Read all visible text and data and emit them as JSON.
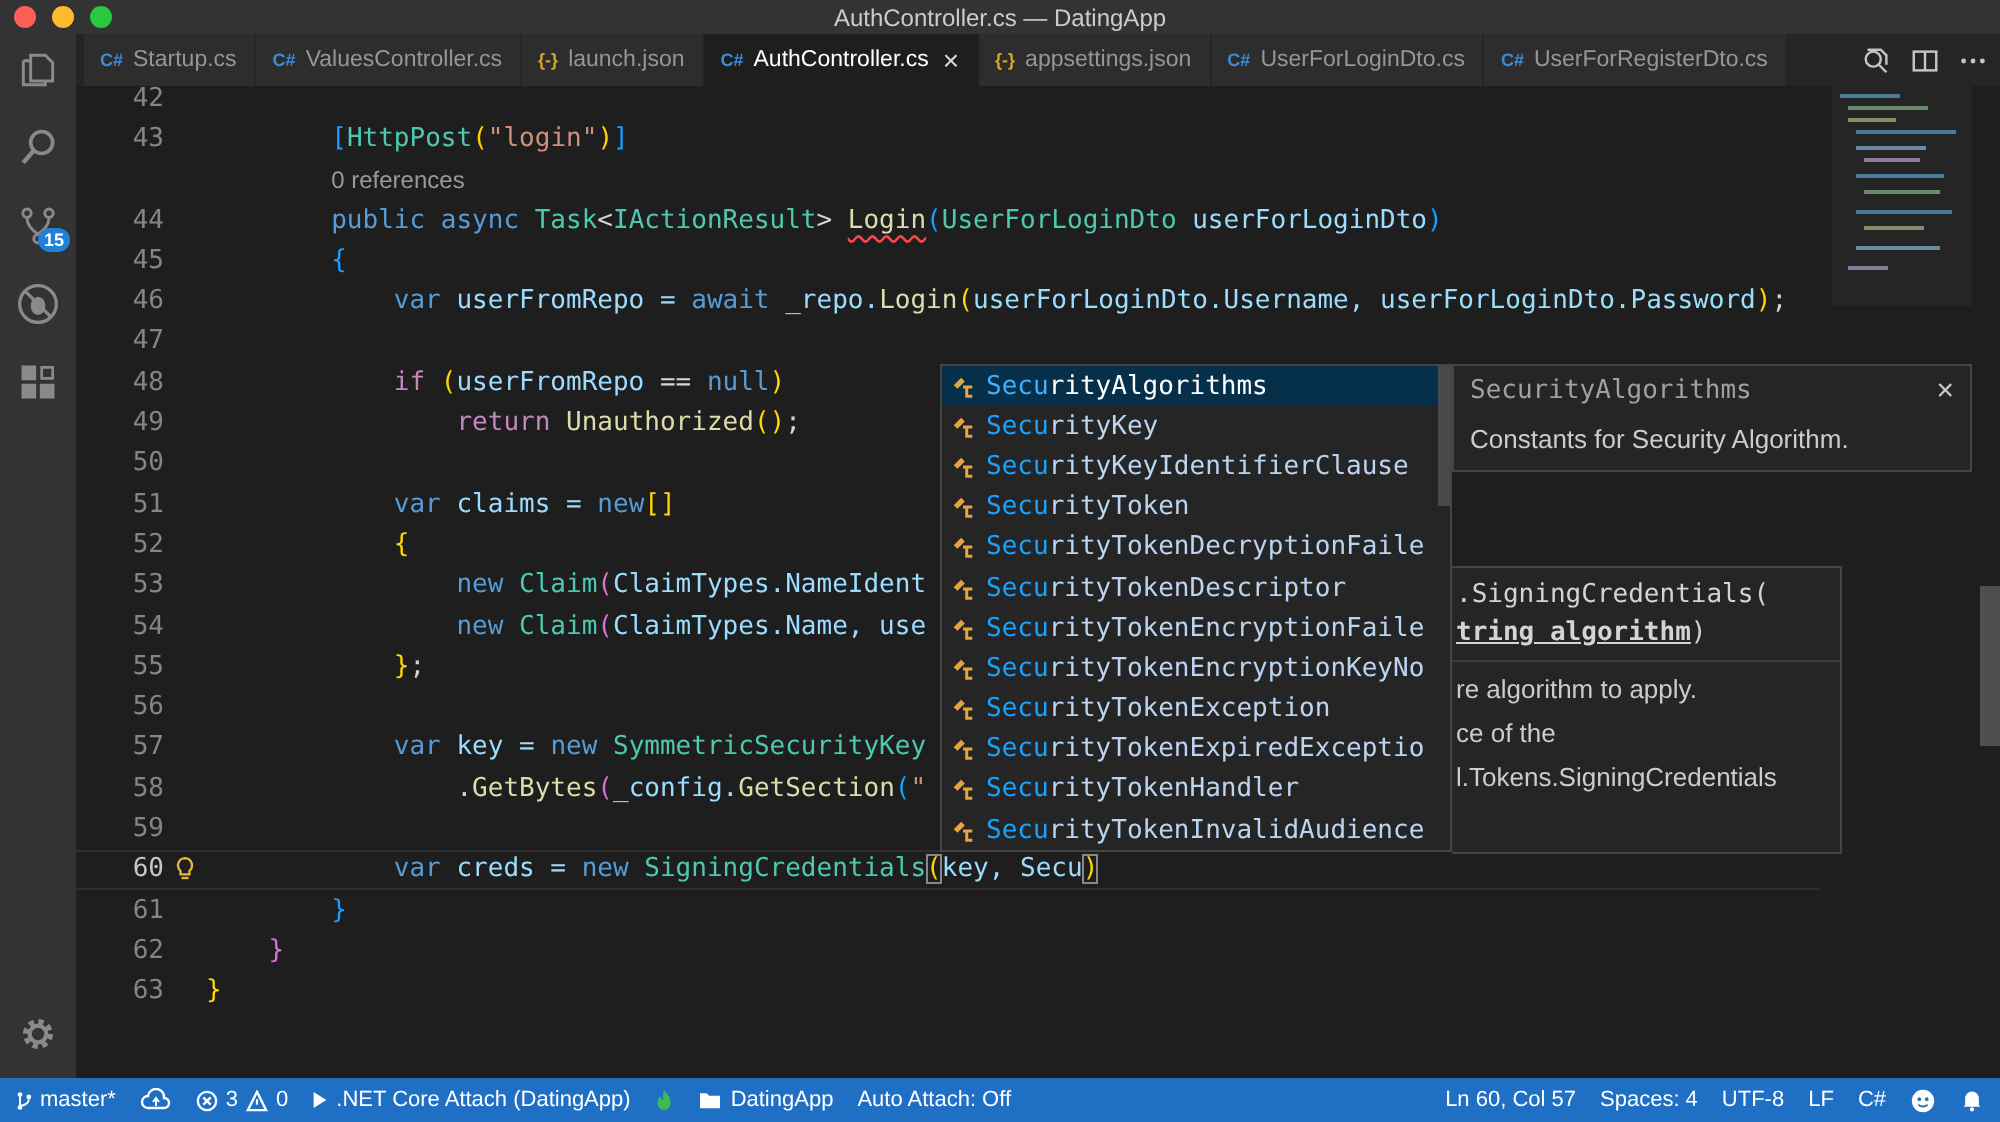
{
  "window": {
    "title": "AuthController.cs — DatingApp"
  },
  "tabs": [
    {
      "icon": "C#",
      "kind": "cs",
      "label": "Startup.cs",
      "selected": false
    },
    {
      "icon": "C#",
      "kind": "cs",
      "label": "ValuesController.cs",
      "selected": false
    },
    {
      "icon": "{-}",
      "kind": "json",
      "label": "launch.json",
      "selected": false
    },
    {
      "icon": "C#",
      "kind": "cs",
      "label": "AuthController.cs",
      "selected": true,
      "close": "×"
    },
    {
      "icon": "{-}",
      "kind": "json",
      "label": "appsettings.json",
      "selected": false
    },
    {
      "icon": "C#",
      "kind": "cs",
      "label": "UserForLoginDto.cs",
      "selected": false
    },
    {
      "icon": "C#",
      "kind": "cs",
      "label": "UserForRegisterDto.cs",
      "selected": false
    }
  ],
  "activity_bar": {
    "source_control_badge": "15"
  },
  "editor": {
    "lines": [
      {
        "children": [
          {
            "children": [
              {
                "number": "42",
                "current": false
              },
              {
                "number": "43",
                "current": false,
                "tokens": [
                  {
                    "text": "[",
                    "kind": "br3"
                  },
                  {
                    "text": "HttpPost",
                    "kind": "type"
                  },
                  {
                    "text": "(",
                    "kind": "br1"
                  },
                  {
                    "text": "\"login\"",
                    "kind": "str"
                  },
                  {
                    "text": ")",
                    "kind": "br1"
                  },
                  {
                    "text": "]",
                    "kind": "br3"
                  }
                ]
              },
              {
                "kind": "codelens",
                "tokens": [
                  {
                    "text": "0 references",
                    "kind": "txt"
                  }
                ]
              },
              {
                "number": "44",
                "current": false,
                "tokens": [
                  {
                    "text": "public async ",
                    "kind": "kw"
                  },
                  {
                    "text": "Task",
                    "kind": "type"
                  },
                  {
                    "text": "<",
                    "kind": "txt"
                  },
                  {
                    "text": "IActionResult",
                    "kind": "type"
                  },
                  {
                    "text": "> ",
                    "kind": "txt"
                  },
                  {
                    "text": "Login",
                    "kind": "err"
                  },
                  {
                    "text": "(",
                    "kind": "br3"
                  },
                  {
                    "text": "UserForLoginDto",
                    "kind": "type"
                  },
                  {
                    "text": " userForLoginDto",
                    "kind": "var"
                  },
                  {
                    "text": ")",
                    "kind": "br3"
                  }
                ]
              },
              {
                "number": "45",
                "current": false,
                "tokens": [
                  {
                    "text": "{",
                    "kind": "br3"
                  }
                ],
                "children": [
                  {
                    "number": "46",
                    "current": false,
                    "tokens": [
                      {
                        "text": "var",
                        "kind": "kw"
                      },
                      {
                        "text": " userFromRepo = ",
                        "kind": "var"
                      },
                      {
                        "text": "await",
                        "kind": "kw"
                      },
                      {
                        "text": " _repo.",
                        "kind": "var"
                      },
                      {
                        "text": "Login",
                        "kind": "fn"
                      },
                      {
                        "text": "(",
                        "kind": "br1"
                      },
                      {
                        "text": "userForLoginDto.Username, userForLoginDto.Password",
                        "kind": "var"
                      },
                      {
                        "text": ")",
                        "kind": "br1"
                      },
                      {
                        "text": ";",
                        "kind": "txt"
                      }
                    ]
                  },
                  {
                    "number": "47",
                    "current": false
                  },
                  {
                    "number": "48",
                    "current": false,
                    "tokens": [
                      {
                        "text": "if",
                        "kind": "ctl"
                      },
                      {
                        "text": " (",
                        "kind": "br1"
                      },
                      {
                        "text": "userFromRepo",
                        "kind": "var"
                      },
                      {
                        "text": " == ",
                        "kind": "txt"
                      },
                      {
                        "text": "null",
                        "kind": "kw"
                      },
                      {
                        "text": ")",
                        "kind": "br1"
                      }
                    ],
                    "children": [
                      {
                        "number": "49",
                        "current": false,
                        "tokens": [
                          {
                            "text": "return",
                            "kind": "ctl"
                          },
                          {
                            "text": " Unauthorized",
                            "kind": "fn"
                          },
                          {
                            "text": "()",
                            "kind": "br1"
                          },
                          {
                            "text": ";",
                            "kind": "txt"
                          }
                        ]
                      }
                    ]
                  },
                  {
                    "number": "50",
                    "current": false
                  },
                  {
                    "number": "51",
                    "current": false,
                    "tokens": [
                      {
                        "text": "var",
                        "kind": "kw"
                      },
                      {
                        "text": " claims = ",
                        "kind": "var"
                      },
                      {
                        "text": "new",
                        "kind": "kw"
                      },
                      {
                        "text": "[]",
                        "kind": "br1"
                      }
                    ]
                  },
                  {
                    "number": "52",
                    "current": false,
                    "tokens": [
                      {
                        "text": "{",
                        "kind": "br1"
                      }
                    ],
                    "children": [
                      {
                        "number": "53",
                        "current": false,
                        "tokens": [
                          {
                            "text": "new",
                            "kind": "kw"
                          },
                          {
                            "text": " Claim",
                            "kind": "type"
                          },
                          {
                            "text": "(",
                            "kind": "br2"
                          },
                          {
                            "text": "ClaimTypes.NameIdent",
                            "kind": "var"
                          }
                        ]
                      },
                      {
                        "number": "54",
                        "current": false,
                        "tokens": [
                          {
                            "text": "new",
                            "kind": "kw"
                          },
                          {
                            "text": " Claim",
                            "kind": "type"
                          },
                          {
                            "text": "(",
                            "kind": "br2"
                          },
                          {
                            "text": "ClaimTypes.Name, use",
                            "kind": "var"
                          }
                        ]
                      }
                    ]
                  },
                  {
                    "number": "55",
                    "current": false,
                    "tokens": [
                      {
                        "text": "}",
                        "kind": "br1"
                      },
                      {
                        "text": ";",
                        "kind": "txt"
                      }
                    ]
                  },
                  {
                    "number": "56",
                    "current": false
                  },
                  {
                    "number": "57",
                    "current": false,
                    "tokens": [
                      {
                        "text": "var",
                        "kind": "kw"
                      },
                      {
                        "text": " key = ",
                        "kind": "var"
                      },
                      {
                        "text": "new",
                        "kind": "kw"
                      },
                      {
                        "text": " SymmetricSecurityKey",
                        "kind": "type"
                      }
                    ],
                    "children": [
                      {
                        "number": "58",
                        "current": false,
                        "tokens": [
                          {
                            "text": ".",
                            "kind": "txt"
                          },
                          {
                            "text": "GetBytes",
                            "kind": "fn"
                          },
                          {
                            "text": "(",
                            "kind": "br2"
                          },
                          {
                            "text": "_config.",
                            "kind": "var"
                          },
                          {
                            "text": "GetSection",
                            "kind": "fn"
                          },
                          {
                            "text": "(",
                            "kind": "br3"
                          },
                          {
                            "text": "\"",
                            "kind": "str"
                          }
                        ]
                      }
                    ]
                  },
                  {
                    "number": "59",
                    "current": false
                  },
                  {
                    "number": "60",
                    "current": true,
                    "tokens": [
                      {
                        "text": "var",
                        "kind": "kw"
                      },
                      {
                        "text": " creds = ",
                        "kind": "var"
                      },
                      {
                        "text": "new",
                        "kind": "kw"
                      },
                      {
                        "text": " SigningCredentials",
                        "kind": "type"
                      },
                      {
                        "text": "(",
                        "kind": "match"
                      },
                      {
                        "text": "key, Secu",
                        "kind": "var"
                      },
                      {
                        "text": ")",
                        "kind": "match"
                      }
                    ]
                  }
                ]
              },
              {
                "number": "61",
                "current": false,
                "tokens": [
                  {
                    "text": "}",
                    "kind": "br3"
                  }
                ]
              }
            ]
          },
          {
            "number": "62",
            "current": false,
            "tokens": [
              {
                "text": "}",
                "kind": "br2"
              }
            ]
          }
        ]
      },
      {
        "number": "63",
        "current": false,
        "tokens": [
          {
            "text": "}",
            "kind": "br1"
          }
        ]
      }
    ]
  },
  "suggestions": [
    {
      "match": "Secu",
      "rest": "rityAlgorithms",
      "selected": true
    },
    {
      "match": "Secu",
      "rest": "rityKey",
      "selected": false
    },
    {
      "match": "Secu",
      "rest": "rityKeyIdentifierClause",
      "selected": false
    },
    {
      "match": "Secu",
      "rest": "rityToken",
      "selected": false
    },
    {
      "match": "Secu",
      "rest": "rityTokenDecryptionFaile",
      "selected": false
    },
    {
      "match": "Secu",
      "rest": "rityTokenDescriptor",
      "selected": false
    },
    {
      "match": "Secu",
      "rest": "rityTokenEncryptionFaile",
      "selected": false
    },
    {
      "match": "Secu",
      "rest": "rityTokenEncryptionKeyNo",
      "selected": false
    },
    {
      "match": "Secu",
      "rest": "rityTokenException",
      "selected": false
    },
    {
      "match": "Secu",
      "rest": "rityTokenExpiredExceptio",
      "selected": false
    },
    {
      "match": "Secu",
      "rest": "rityTokenHandler",
      "selected": false
    },
    {
      "match": "Secu",
      "rest": "rityTokenInvalidAudience",
      "selected": false
    }
  ],
  "suggestion_details": {
    "title": "SecurityAlgorithms",
    "description": "Constants for Security Algorithm.",
    "close": "×"
  },
  "parameter_hint": {
    "signature_head": ".SigningCredentials(",
    "parameter": "tring algorithm",
    "signature_tail": ")",
    "doc_lines": [
      "re algorithm to apply.",
      "ce of the",
      "l.Tokens.SigningCredentials"
    ]
  },
  "status_bar": {
    "branch": "master*",
    "errors": "3",
    "warnings": "0",
    "debug_config": ".NET Core Attach (DatingApp)",
    "folder": "DatingApp",
    "auto_attach": "Auto Attach: Off",
    "position": "Ln 60, Col 57",
    "spaces": "Spaces: 4",
    "encoding": "UTF-8",
    "eol": "LF",
    "language": "C#"
  }
}
